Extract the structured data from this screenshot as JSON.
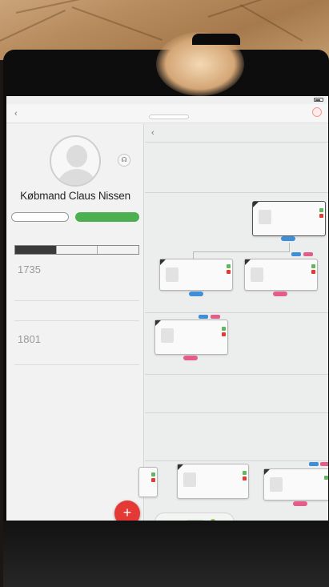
{
  "status": {
    "carrier": "",
    "time": ""
  },
  "navbar": {
    "back_icon": "chevron-left-icon",
    "title": "",
    "action_icon": "share-icon"
  },
  "profile": {
    "name": "Købmand Claus Nissen",
    "subtitle": "",
    "count": "",
    "headset_icon": "headset-icon",
    "btn_outline": "",
    "btn_green": ""
  },
  "tabs": [
    "",
    "",
    ""
  ],
  "events": [
    {
      "year": "1735",
      "title": "",
      "lines": [
        "",
        ""
      ],
      "extra": ""
    },
    {
      "year": "1801",
      "title": "",
      "lines": [
        "",
        ""
      ],
      "extra": ""
    }
  ],
  "fab_label": "+",
  "tree": {
    "hint": "",
    "cards": [
      {
        "name": "",
        "dates": [
          "",
          ""
        ]
      },
      {
        "name": "",
        "dates": [
          ""
        ]
      },
      {
        "name": "",
        "dates": [
          ""
        ]
      },
      {
        "name": "",
        "dates": [
          ""
        ]
      },
      {
        "name": "",
        "dates": [
          ""
        ]
      },
      {
        "name": "",
        "dates": [
          ""
        ]
      }
    ]
  },
  "colors": {
    "accent_green": "#4caf50",
    "fab_red": "#e53935",
    "male_blue": "#3f8fd8",
    "female_pink": "#e35d8a"
  }
}
